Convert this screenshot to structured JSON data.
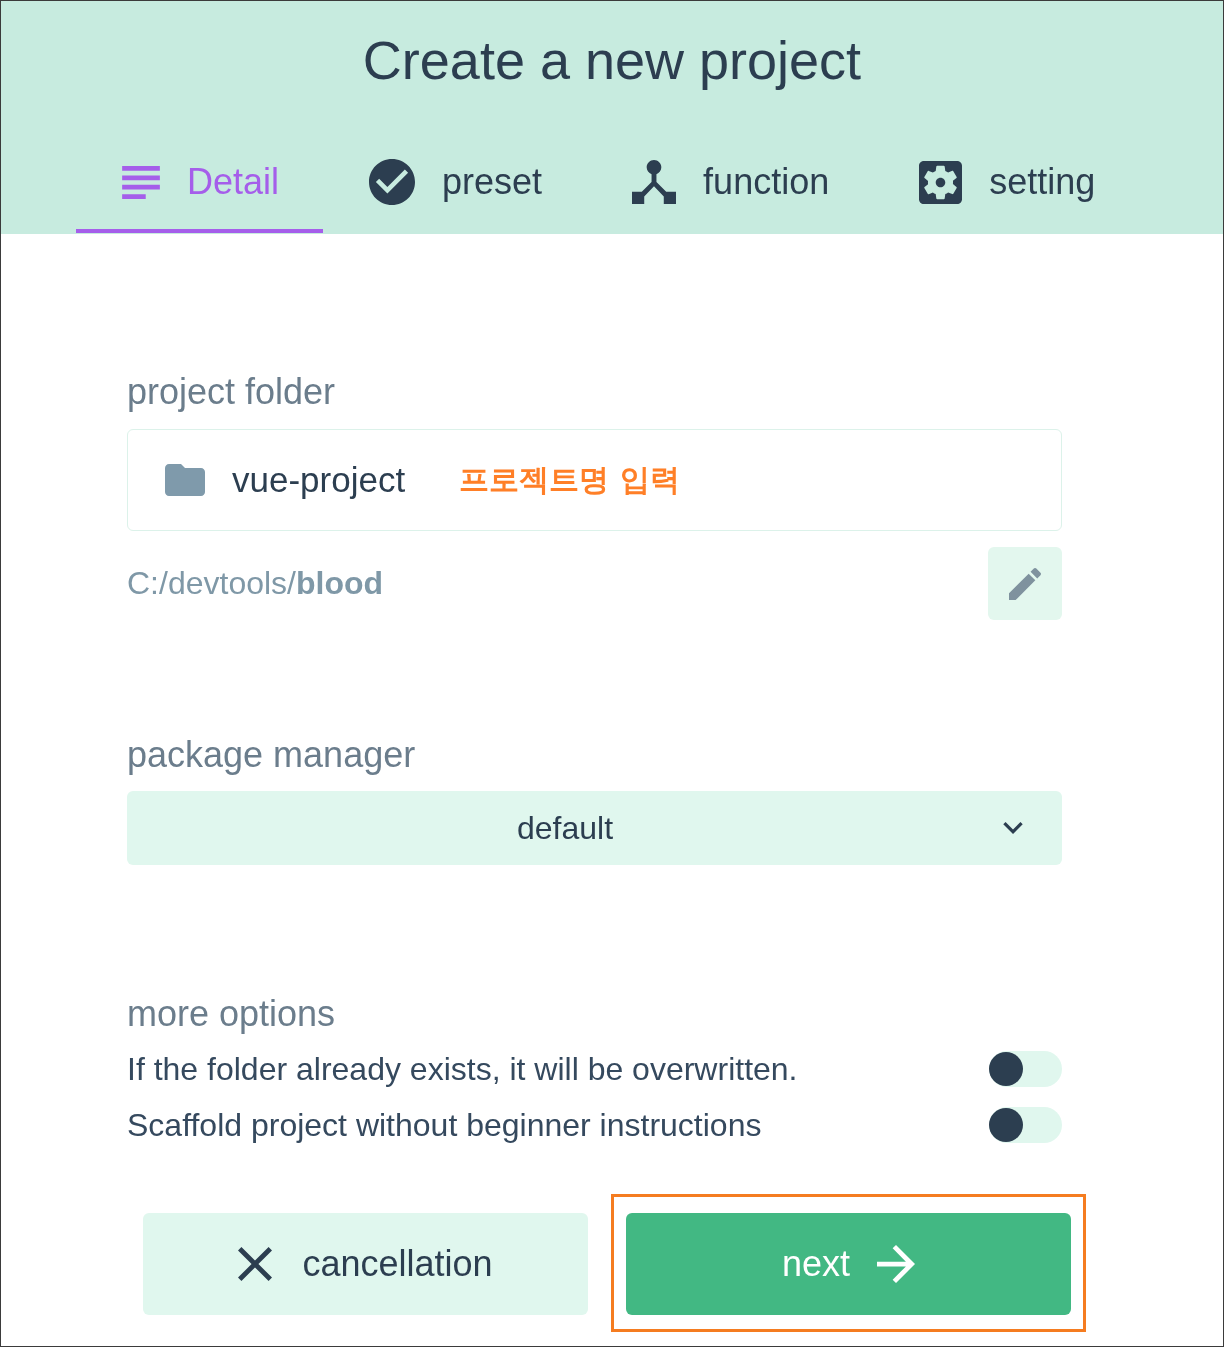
{
  "header": {
    "title": "Create a new project"
  },
  "tabs": [
    {
      "label": "Detail",
      "selected": true
    },
    {
      "label": "preset",
      "selected": false
    },
    {
      "label": "function",
      "selected": false
    },
    {
      "label": "setting",
      "selected": false
    }
  ],
  "project_folder": {
    "label": "project folder",
    "value": "vue-project",
    "annotation": "프로젝트명 입력",
    "path": "C:/devtools/**blood**"
  },
  "package_manager": {
    "label": "package manager",
    "value": "default"
  },
  "more_options": {
    "label": "more options",
    "options": [
      {
        "label": "If the folder already exists, it will be overwritten.",
        "on": false
      },
      {
        "label": "Scaffold project without beginner instructions",
        "on": false
      }
    ]
  },
  "buttons": [
    {
      "label": "cancellation",
      "kind": "secondary",
      "highlighted": false
    },
    {
      "label": "next",
      "kind": "primary",
      "highlighted": true
    }
  ]
}
